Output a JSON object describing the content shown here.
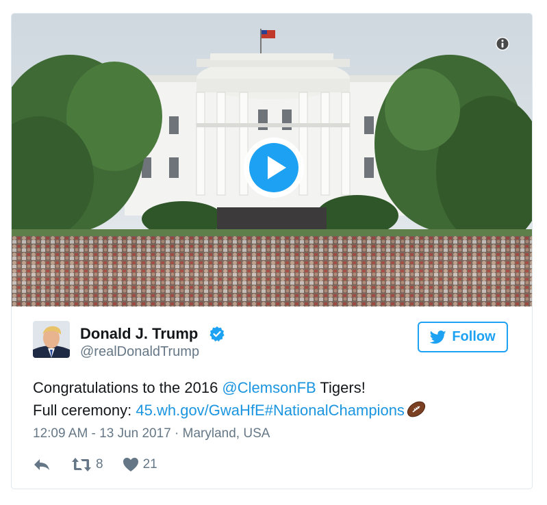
{
  "tweet": {
    "author_name": "Donald J. Trump",
    "author_handle": "@realDonaldTrump",
    "follow_label": "Follow",
    "text_line1_a": "Congratulations to the 2016 ",
    "mention": "@ClemsonFB",
    "text_line1_b": " Tigers!",
    "text_line2_a": "Full ceremony: ",
    "link": "45.wh.gov/GwaHfE",
    "hashtag": "#NationalChampions",
    "timestamp": "12:09 AM - 13 Jun 2017",
    "separator": " · ",
    "location": "Maryland, USA",
    "retweet_count": "8",
    "like_count": "21"
  },
  "icons": {
    "info": "info-icon",
    "play": "play-icon",
    "verified": "verified-badge-icon",
    "bird": "twitter-bird-icon",
    "reply": "reply-icon",
    "retweet": "retweet-icon",
    "like": "heart-icon",
    "emoji": "american-football-emoji"
  },
  "colors": {
    "accent": "#1da1f2",
    "link": "#1b95e0",
    "muted": "#657786",
    "text": "#14171a"
  }
}
